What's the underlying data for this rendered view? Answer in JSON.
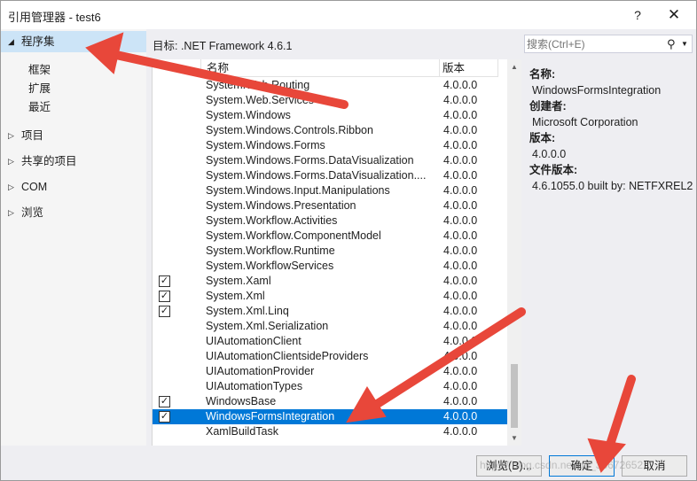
{
  "window": {
    "title": "引用管理器 - test6",
    "help": "?",
    "close": "✕"
  },
  "nav": {
    "selected": "程序集",
    "sub_items": [
      "框架",
      "扩展",
      "最近"
    ],
    "items": [
      "项目",
      "共享的项目",
      "COM",
      "浏览"
    ]
  },
  "target_label": "目标: .NET Framework 4.6.1",
  "columns": {
    "name": "名称",
    "version": "版本"
  },
  "rows": [
    {
      "name": "System.Web.Routing",
      "version": "4.0.0.0",
      "checked": false,
      "selected": false
    },
    {
      "name": "System.Web.Services",
      "version": "4.0.0.0",
      "checked": false,
      "selected": false
    },
    {
      "name": "System.Windows",
      "version": "4.0.0.0",
      "checked": false,
      "selected": false
    },
    {
      "name": "System.Windows.Controls.Ribbon",
      "version": "4.0.0.0",
      "checked": false,
      "selected": false
    },
    {
      "name": "System.Windows.Forms",
      "version": "4.0.0.0",
      "checked": false,
      "selected": false
    },
    {
      "name": "System.Windows.Forms.DataVisualization",
      "version": "4.0.0.0",
      "checked": false,
      "selected": false
    },
    {
      "name": "System.Windows.Forms.DataVisualization....",
      "version": "4.0.0.0",
      "checked": false,
      "selected": false
    },
    {
      "name": "System.Windows.Input.Manipulations",
      "version": "4.0.0.0",
      "checked": false,
      "selected": false
    },
    {
      "name": "System.Windows.Presentation",
      "version": "4.0.0.0",
      "checked": false,
      "selected": false
    },
    {
      "name": "System.Workflow.Activities",
      "version": "4.0.0.0",
      "checked": false,
      "selected": false
    },
    {
      "name": "System.Workflow.ComponentModel",
      "version": "4.0.0.0",
      "checked": false,
      "selected": false
    },
    {
      "name": "System.Workflow.Runtime",
      "version": "4.0.0.0",
      "checked": false,
      "selected": false
    },
    {
      "name": "System.WorkflowServices",
      "version": "4.0.0.0",
      "checked": false,
      "selected": false
    },
    {
      "name": "System.Xaml",
      "version": "4.0.0.0",
      "checked": true,
      "selected": false
    },
    {
      "name": "System.Xml",
      "version": "4.0.0.0",
      "checked": true,
      "selected": false
    },
    {
      "name": "System.Xml.Linq",
      "version": "4.0.0.0",
      "checked": true,
      "selected": false
    },
    {
      "name": "System.Xml.Serialization",
      "version": "4.0.0.0",
      "checked": false,
      "selected": false
    },
    {
      "name": "UIAutomationClient",
      "version": "4.0.0.0",
      "checked": false,
      "selected": false
    },
    {
      "name": "UIAutomationClientsideProviders",
      "version": "4.0.0.0",
      "checked": false,
      "selected": false
    },
    {
      "name": "UIAutomationProvider",
      "version": "4.0.0.0",
      "checked": false,
      "selected": false
    },
    {
      "name": "UIAutomationTypes",
      "version": "4.0.0.0",
      "checked": false,
      "selected": false
    },
    {
      "name": "WindowsBase",
      "version": "4.0.0.0",
      "checked": true,
      "selected": false
    },
    {
      "name": "WindowsFormsIntegration",
      "version": "4.0.0.0",
      "checked": true,
      "selected": true
    },
    {
      "name": "XamlBuildTask",
      "version": "4.0.0.0",
      "checked": false,
      "selected": false
    }
  ],
  "search": {
    "placeholder": "搜索(Ctrl+E)",
    "icon": "search-icon"
  },
  "details": {
    "name_label": "名称:",
    "name_value": "WindowsFormsIntegration",
    "author_label": "创建者:",
    "author_value": "Microsoft Corporation",
    "version_label": "版本:",
    "version_value": "4.0.0.0",
    "file_version_label": "文件版本:",
    "file_version_value": "4.6.1055.0 built by: NETFXREL2"
  },
  "buttons": {
    "browse": "浏览(B)...",
    "ok": "确定",
    "cancel": "取消"
  },
  "watermark": "https://blog.csdn.net/qq_38672652",
  "colors": {
    "accent": "#0078d7",
    "selection": "#cce4f7",
    "annotation_arrow": "#e8473a"
  }
}
